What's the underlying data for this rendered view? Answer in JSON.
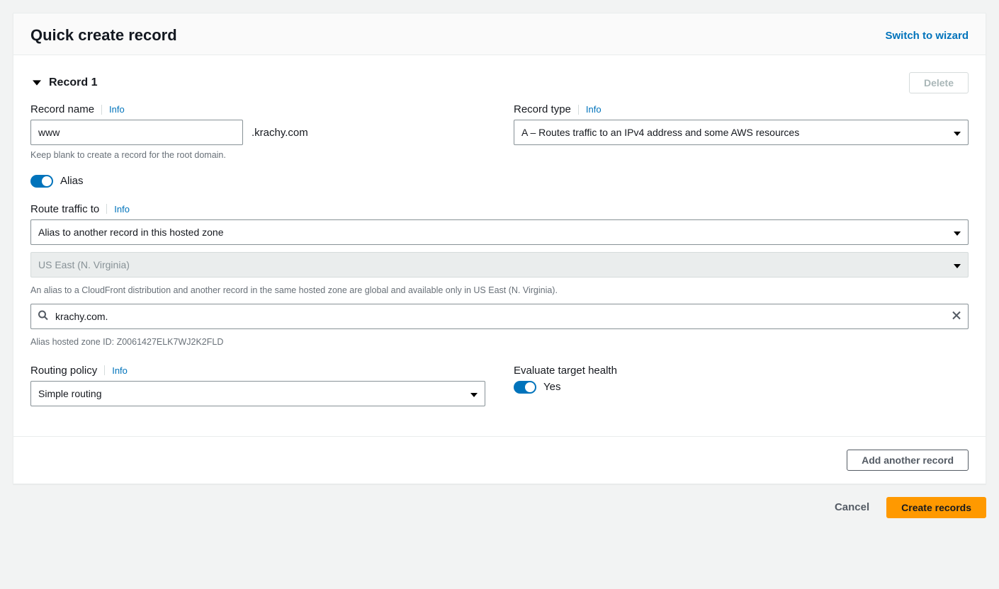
{
  "header": {
    "title": "Quick create record",
    "switch_link": "Switch to wizard"
  },
  "info_label": "Info",
  "record_section_title": "Record 1",
  "delete_button": "Delete",
  "record_name": {
    "label": "Record name",
    "value": "www",
    "suffix": ".krachy.com",
    "help": "Keep blank to create a record for the root domain."
  },
  "record_type": {
    "label": "Record type",
    "selected": "A – Routes traffic to an IPv4 address and some AWS resources"
  },
  "alias_toggle": {
    "label": "Alias"
  },
  "route_to": {
    "label": "Route traffic to",
    "endpoint_selected": "Alias to another record in this hosted zone",
    "region_selected": "US East (N. Virginia)",
    "global_note": "An alias to a CloudFront distribution and another record in the same hosted zone are global and available only in US East (N. Virginia).",
    "target_value": "krachy.com.",
    "hosted_zone_note": "Alias hosted zone ID: Z0061427ELK7WJ2K2FLD"
  },
  "routing_policy": {
    "label": "Routing policy",
    "selected": "Simple routing"
  },
  "evaluate_health": {
    "label": "Evaluate target health",
    "value_label": "Yes"
  },
  "add_another_button": "Add another record",
  "footer": {
    "cancel": "Cancel",
    "create": "Create records"
  }
}
